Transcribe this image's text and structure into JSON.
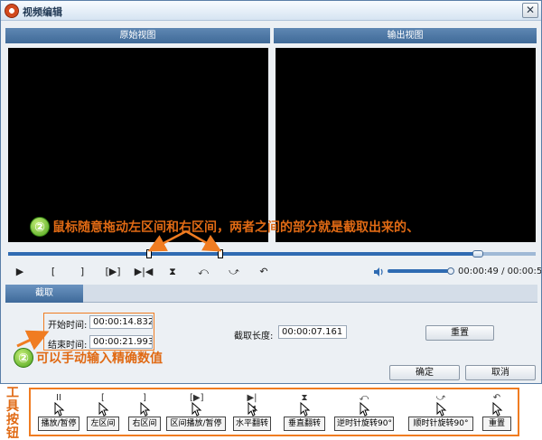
{
  "window": {
    "title": "视频编辑",
    "close_glyph": "✕"
  },
  "views": {
    "original_label": "原始视图",
    "output_label": "输出视图"
  },
  "annotations": {
    "number_glyph": "②",
    "drag_hint": "鼠标随意拖动左区间和右区间，两者之间的部分就是截取出来的、",
    "input_hint": "可以手动输入精确数值",
    "toolbar_caption": "工具按钮"
  },
  "playback": {
    "progress_fraction": 0.89,
    "controls": [
      {
        "icon": "play-icon",
        "glyph": "▶"
      },
      {
        "icon": "mark-in-icon",
        "glyph": "["
      },
      {
        "icon": "mark-out-icon",
        "glyph": "]"
      },
      {
        "icon": "play-range-icon",
        "glyph": "[▶]"
      },
      {
        "icon": "flip-horizontal-icon",
        "glyph": "▶|◀"
      },
      {
        "icon": "flip-vertical-icon",
        "glyph": "⧗"
      },
      {
        "icon": "rotate-ccw-icon",
        "glyph": "⤺"
      },
      {
        "icon": "rotate-cw-icon",
        "glyph": "⤻"
      },
      {
        "icon": "reset-icon",
        "glyph": "↶"
      }
    ],
    "volume_fraction": 1.0,
    "time_readout": "00:00:49 / 00:00:55"
  },
  "tabs": {
    "crop_label": "截取"
  },
  "crop": {
    "start_label": "开始时间:",
    "start_value": "00:00:14.832",
    "end_label": "结束时间:",
    "end_value": "00:00:21.993",
    "length_label": "截取长度:",
    "length_value": "00:00:07.161",
    "reset_label": "重置"
  },
  "dialog_buttons": {
    "ok_label": "确定",
    "cancel_label": "取消"
  },
  "toolbar_legend": [
    {
      "icon": "pause-icon",
      "glyph": "II",
      "label": "播放/暂停"
    },
    {
      "icon": "mark-in-icon",
      "glyph": "[",
      "label": "左区间"
    },
    {
      "icon": "mark-out-icon",
      "glyph": "]",
      "label": "右区间"
    },
    {
      "icon": "play-range-icon",
      "glyph": "[▶]",
      "label": "区间播放/暂停"
    },
    {
      "icon": "flip-horizontal-icon",
      "glyph": "▶|◀",
      "label": "水平翻转"
    },
    {
      "icon": "flip-vertical-icon",
      "glyph": "⧗",
      "label": "垂直翻转"
    },
    {
      "icon": "rotate-ccw-icon",
      "glyph": "⤺",
      "label": "逆时针旋转90°"
    },
    {
      "icon": "rotate-cw-icon",
      "glyph": "⤻",
      "label": "顺时针旋转90°"
    },
    {
      "icon": "reset-icon",
      "glyph": "↶",
      "label": "重置"
    }
  ],
  "colors": {
    "accent": "#f07c21",
    "header_blue": "#4a76a6",
    "slider_blue": "#2f6bb2"
  }
}
